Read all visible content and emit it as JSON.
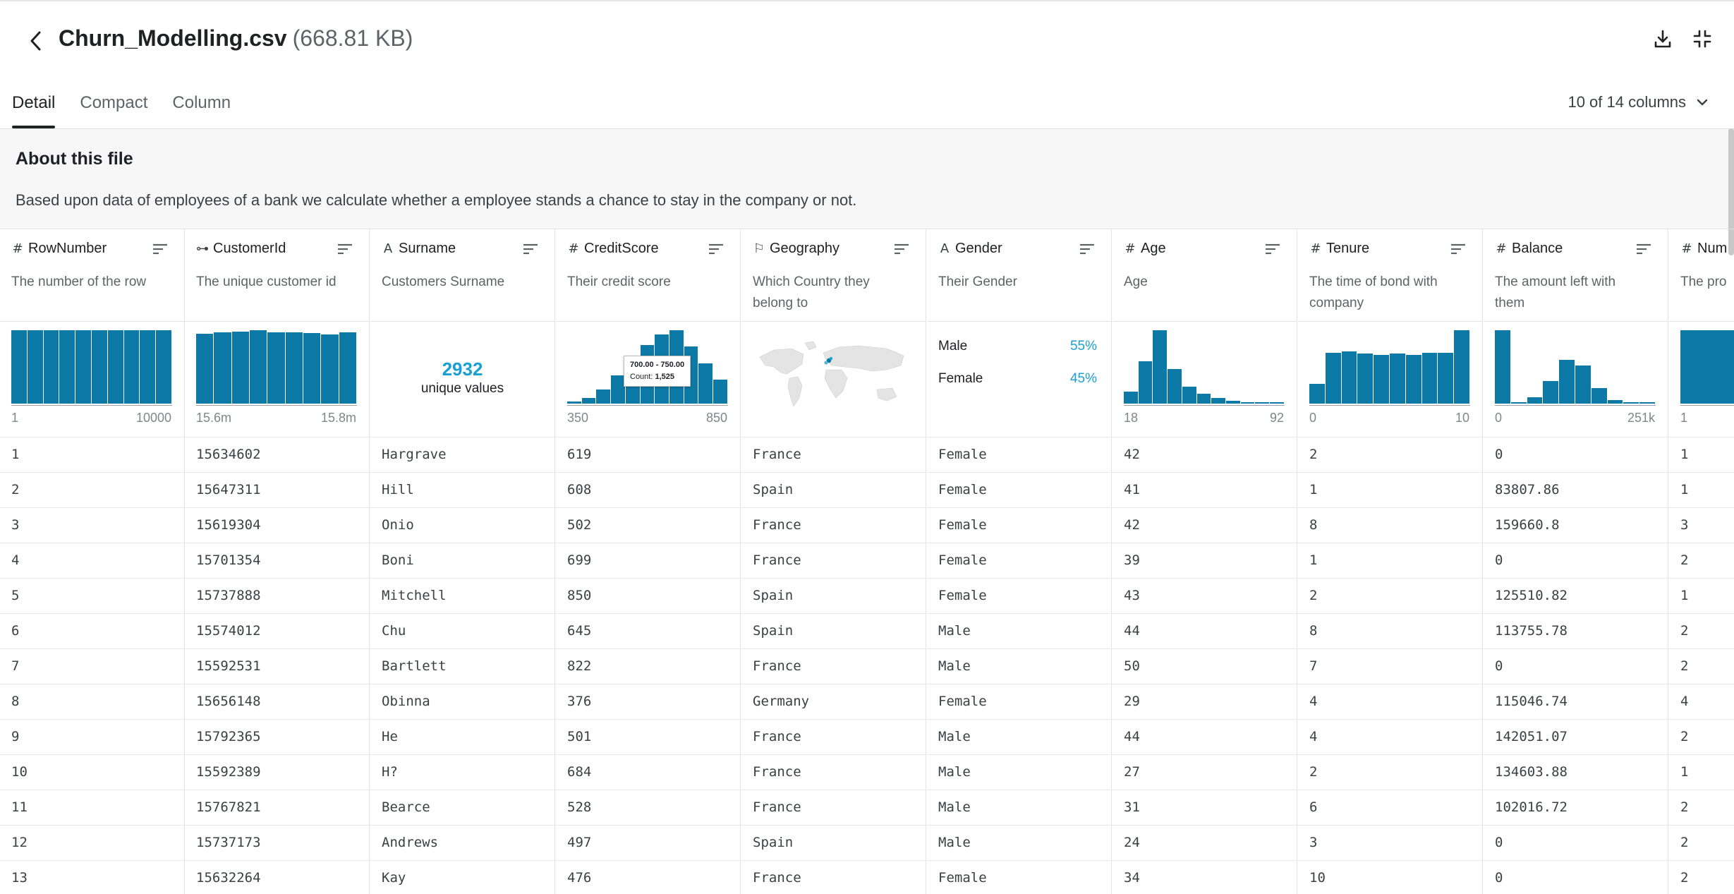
{
  "header": {
    "file_name": "Churn_Modelling.csv",
    "file_size": "(668.81 KB)",
    "back_icon": "chevron-left-icon",
    "download_icon": "download-icon",
    "collapse_icon": "collapse-icon"
  },
  "tabs": [
    {
      "label": "Detail",
      "active": true
    },
    {
      "label": "Compact",
      "active": false
    },
    {
      "label": "Column",
      "active": false
    }
  ],
  "column_selector": {
    "label": "10 of 14 columns",
    "icon": "chevron-down-icon"
  },
  "about": {
    "title": "About this file",
    "description": "Based upon data of employees of a bank we calculate whether a employee stands a chance to stay in the company or not."
  },
  "colors": {
    "accent": "#0d79a6",
    "highlight": "#1a9fd5"
  },
  "columns": [
    {
      "name": "RowNumber",
      "type_icon": "#",
      "description": "The number of the row",
      "summary": {
        "kind": "histogram",
        "relative_counts": [
          1,
          1,
          1,
          1,
          1,
          1,
          1,
          1,
          1,
          1
        ],
        "min_label": "1",
        "max_label": "10000"
      }
    },
    {
      "name": "CustomerId",
      "type_icon": "⊶",
      "description": "The unique customer id",
      "summary": {
        "kind": "histogram",
        "relative_counts": [
          0.95,
          0.97,
          0.98,
          1,
          0.97,
          0.97,
          0.96,
          0.94,
          0.97
        ],
        "min_label": "15.6m",
        "max_label": "15.8m"
      }
    },
    {
      "name": "Surname",
      "type_icon": "A",
      "description": "Customers Surname",
      "summary": {
        "kind": "unique",
        "value": "2932",
        "label": "unique values"
      }
    },
    {
      "name": "CreditScore",
      "type_icon": "#",
      "description": "Their credit score",
      "summary": {
        "kind": "histogram",
        "relative_counts": [
          0.03,
          0.08,
          0.19,
          0.38,
          0.58,
          0.8,
          0.94,
          1,
          0.78,
          0.55,
          0.33
        ],
        "min_label": "350",
        "max_label": "850",
        "tooltip": {
          "range": "700.00 - 750.00",
          "count_label": "Count:",
          "count": "1,525"
        }
      }
    },
    {
      "name": "Geography",
      "type_icon": "⚐",
      "description": "Which Country they belong to",
      "summary": {
        "kind": "map"
      }
    },
    {
      "name": "Gender",
      "type_icon": "A",
      "description": "Their Gender",
      "summary": {
        "kind": "categories",
        "items": [
          {
            "label": "Male",
            "pct": "55%"
          },
          {
            "label": "Female",
            "pct": "45%"
          }
        ]
      }
    },
    {
      "name": "Age",
      "type_icon": "#",
      "description": "Age",
      "summary": {
        "kind": "histogram",
        "relative_counts": [
          0.16,
          0.58,
          1,
          0.47,
          0.23,
          0.13,
          0.08,
          0.04,
          0.02,
          0.01,
          0.005
        ],
        "min_label": "18",
        "max_label": "92"
      }
    },
    {
      "name": "Tenure",
      "type_icon": "#",
      "description": "The time of bond with company",
      "summary": {
        "kind": "histogram",
        "relative_counts": [
          0.27,
          0.69,
          0.71,
          0.68,
          0.66,
          0.68,
          0.66,
          0.69,
          0.69,
          1
        ],
        "min_label": "0",
        "max_label": "10"
      }
    },
    {
      "name": "Balance",
      "type_icon": "#",
      "description": "The amount left with them",
      "summary": {
        "kind": "histogram",
        "relative_counts": [
          1,
          0.02,
          0.09,
          0.31,
          0.6,
          0.52,
          0.21,
          0.05,
          0.01,
          0.005
        ],
        "min_label": "0",
        "max_label": "251k"
      }
    },
    {
      "name": "Num",
      "type_icon": "#",
      "description": "The pro",
      "summary": {
        "kind": "histogram",
        "relative_counts": [
          1,
          0.9
        ],
        "min_label": "1",
        "max_label": ""
      }
    }
  ],
  "rows": [
    [
      "1",
      "15634602",
      "Hargrave",
      "619",
      "France",
      "Female",
      "42",
      "2",
      "0",
      "1"
    ],
    [
      "2",
      "15647311",
      "Hill",
      "608",
      "Spain",
      "Female",
      "41",
      "1",
      "83807.86",
      "1"
    ],
    [
      "3",
      "15619304",
      "Onio",
      "502",
      "France",
      "Female",
      "42",
      "8",
      "159660.8",
      "3"
    ],
    [
      "4",
      "15701354",
      "Boni",
      "699",
      "France",
      "Female",
      "39",
      "1",
      "0",
      "2"
    ],
    [
      "5",
      "15737888",
      "Mitchell",
      "850",
      "Spain",
      "Female",
      "43",
      "2",
      "125510.82",
      "1"
    ],
    [
      "6",
      "15574012",
      "Chu",
      "645",
      "Spain",
      "Male",
      "44",
      "8",
      "113755.78",
      "2"
    ],
    [
      "7",
      "15592531",
      "Bartlett",
      "822",
      "France",
      "Male",
      "50",
      "7",
      "0",
      "2"
    ],
    [
      "8",
      "15656148",
      "Obinna",
      "376",
      "Germany",
      "Female",
      "29",
      "4",
      "115046.74",
      "4"
    ],
    [
      "9",
      "15792365",
      "He",
      "501",
      "France",
      "Male",
      "44",
      "4",
      "142051.07",
      "2"
    ],
    [
      "10",
      "15592389",
      "H?",
      "684",
      "France",
      "Male",
      "27",
      "2",
      "134603.88",
      "1"
    ],
    [
      "11",
      "15767821",
      "Bearce",
      "528",
      "France",
      "Male",
      "31",
      "6",
      "102016.72",
      "2"
    ],
    [
      "12",
      "15737173",
      "Andrews",
      "497",
      "Spain",
      "Male",
      "24",
      "3",
      "0",
      "2"
    ],
    [
      "13",
      "15632264",
      "Kay",
      "476",
      "France",
      "Female",
      "34",
      "10",
      "0",
      "2"
    ]
  ]
}
